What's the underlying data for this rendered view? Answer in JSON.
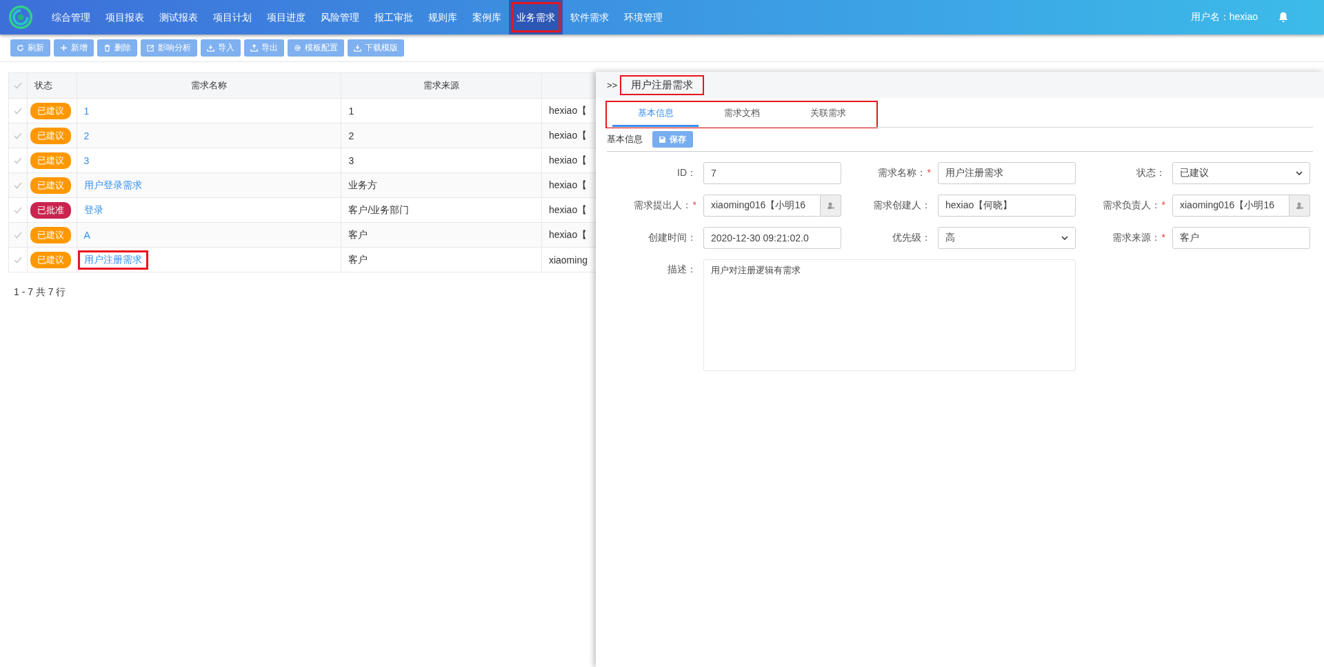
{
  "nav": {
    "items": [
      {
        "label": "综合管理",
        "selected": false,
        "annotated": false
      },
      {
        "label": "项目报表",
        "selected": false,
        "annotated": false
      },
      {
        "label": "测试报表",
        "selected": false,
        "annotated": false
      },
      {
        "label": "项目计划",
        "selected": false,
        "annotated": false
      },
      {
        "label": "项目进度",
        "selected": false,
        "annotated": false
      },
      {
        "label": "风险管理",
        "selected": false,
        "annotated": false
      },
      {
        "label": "报工审批",
        "selected": false,
        "annotated": false
      },
      {
        "label": "规则库",
        "selected": false,
        "annotated": false
      },
      {
        "label": "案例库",
        "selected": false,
        "annotated": false
      },
      {
        "label": "业务需求",
        "selected": true,
        "annotated": true
      },
      {
        "label": "软件需求",
        "selected": false,
        "annotated": false
      },
      {
        "label": "环境管理",
        "selected": false,
        "annotated": false
      }
    ],
    "user": "用户名：hexiao"
  },
  "toolbar": [
    {
      "label": "刷新"
    },
    {
      "label": "新增"
    },
    {
      "label": "删除"
    },
    {
      "label": "影响分析"
    },
    {
      "label": "导入"
    },
    {
      "label": "导出"
    },
    {
      "label": "模板配置"
    },
    {
      "label": "下载模版"
    }
  ],
  "table": {
    "columns": [
      "状态",
      "需求名称",
      "需求来源"
    ],
    "rows": [
      {
        "status": "已建议",
        "color": "#ff9800",
        "name": "1",
        "source": "1",
        "column_4": "hexiao【",
        "annotated": false
      },
      {
        "status": "已建议",
        "color": "#ff9800",
        "name": "2",
        "source": "2",
        "column_4": "hexiao【",
        "annotated": false
      },
      {
        "status": "已建议",
        "color": "#ff9800",
        "name": "3",
        "source": "3",
        "column_4": "hexiao【",
        "annotated": false
      },
      {
        "status": "已建议",
        "color": "#ff9800",
        "name": "用户登录需求",
        "source": "业务方",
        "column_4": "hexiao【",
        "annotated": false
      },
      {
        "status": "已批准",
        "color": "#c9234e",
        "name": "登录",
        "source": "客户/业务部门",
        "column_4": "hexiao【",
        "annotated": false
      },
      {
        "status": "已建议",
        "color": "#ff9800",
        "name": "A",
        "source": "客户",
        "column_4": "hexiao【",
        "annotated": false
      },
      {
        "status": "已建议",
        "color": "#ff9800",
        "name": "用户注册需求",
        "source": "客户",
        "column_4": "xiaoming",
        "annotated": true
      }
    ],
    "pagination": "1 - 7 共 7 行"
  },
  "panel": {
    "prefix": ">>",
    "title": "用户注册需求",
    "title_annotated": true,
    "tabs_annotated": true,
    "tabs": [
      {
        "label": "基本信息",
        "selected": true
      },
      {
        "label": "需求文档",
        "selected": false
      },
      {
        "label": "关联需求",
        "selected": false
      }
    ],
    "section": "基本信息",
    "save": "保存",
    "fields": [
      {
        "kind": "text",
        "label": "ID：",
        "value": "7"
      },
      {
        "kind": "text",
        "label": "需求名称：",
        "required_mark": "*",
        "value": "用户注册需求"
      },
      {
        "kind": "select",
        "label": "状态：",
        "value": "已建议"
      },
      {
        "kind": "picker",
        "label": "需求提出人：",
        "required_mark": "*",
        "value": "xiaoming016【小明16"
      },
      {
        "kind": "text",
        "label": "需求创建人：",
        "value": "hexiao【何晓】"
      },
      {
        "kind": "picker",
        "label": "需求负责人：",
        "required_mark": "*",
        "value": "xiaoming016【小明16"
      },
      {
        "kind": "text",
        "label": "创建时间：",
        "value": "2020-12-30 09:21:02.0"
      },
      {
        "kind": "select",
        "label": "优先级：",
        "value": "高"
      },
      {
        "kind": "text",
        "label": "需求来源：",
        "required_mark": "*",
        "value": "客户"
      },
      {
        "kind": "textarea",
        "label": "描述：",
        "value": "用户对注册逻辑有需求"
      }
    ]
  }
}
